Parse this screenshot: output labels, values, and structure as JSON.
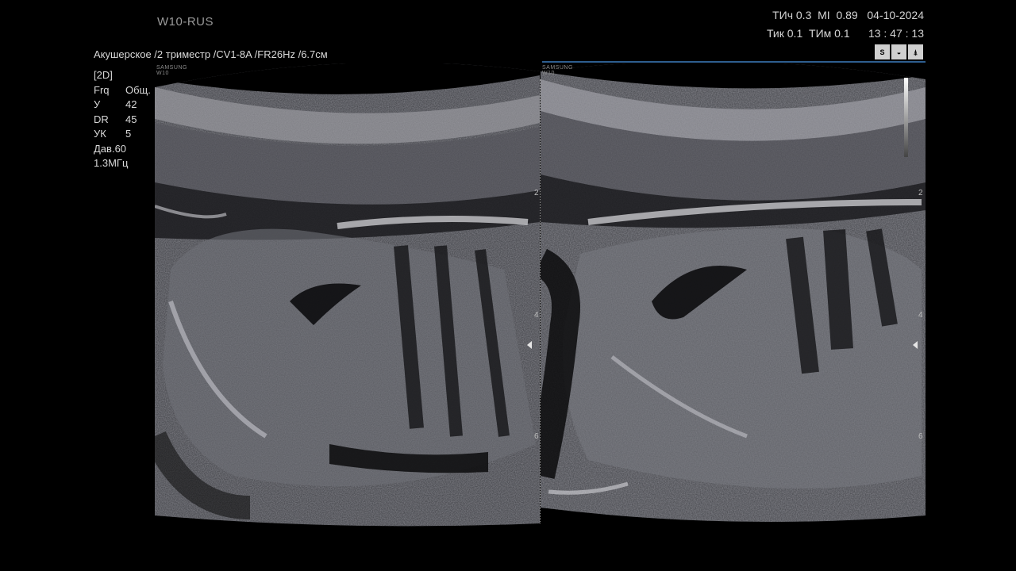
{
  "header": {
    "model": "W10-RUS",
    "preset_line": "Акушерское /2 триместр /CV1-8A /FR26Hz /6.7см",
    "row1": "ТИч 0.3  MI  0.89   04-10-2024",
    "row2": "Тик 0.1  ТИм 0.1      13 : 47 : 13"
  },
  "mode": "[2D]",
  "params": [
    {
      "key": "Frq",
      "value": "Общ."
    },
    {
      "key": "У",
      "value": "42"
    },
    {
      "key": "DR",
      "value": "45"
    },
    {
      "key": "УК",
      "value": "5"
    },
    {
      "key": "Дав.",
      "value": "60"
    },
    {
      "key": "1.3МГц",
      "value": ""
    }
  ],
  "icons": [
    {
      "name": "s-harmonic-icon",
      "label": "S"
    },
    {
      "name": "probe-icon",
      "label": "◒"
    },
    {
      "name": "body-marker-icon",
      "label": "⍋"
    }
  ],
  "brand": {
    "left": "SAMSUNG\nW10",
    "right": "SAMSUNG\nW10"
  },
  "depth_scale": [
    "2",
    "4",
    "6"
  ],
  "colors": {
    "background": "#000000",
    "accent_line": "#2e5e8f",
    "text": "#d4d4d4"
  }
}
